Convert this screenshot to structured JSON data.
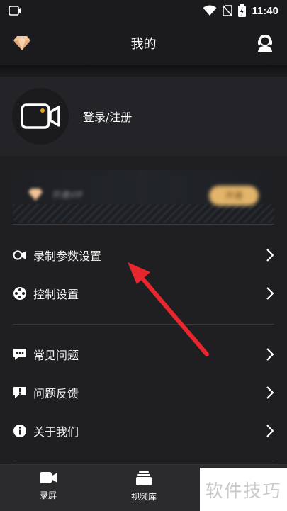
{
  "status_bar": {
    "time": "11:40"
  },
  "header": {
    "title": "我的"
  },
  "profile": {
    "login_label": "登录/注册"
  },
  "vip": {
    "label": "开通VIP",
    "button": "开通"
  },
  "menu": [
    {
      "label": "录制参数设置",
      "icon": "record-settings-icon"
    },
    {
      "label": "控制设置",
      "icon": "control-icon"
    },
    {
      "label": "常见问题",
      "icon": "chat-icon"
    },
    {
      "label": "问题反馈",
      "icon": "feedback-icon"
    },
    {
      "label": "关于我们",
      "icon": "info-icon"
    }
  ],
  "bottom_nav": [
    {
      "label": "录屏",
      "icon": "video-camera-icon"
    },
    {
      "label": "视频库",
      "icon": "video-library-icon"
    }
  ],
  "watermark": "软件技巧",
  "colors": {
    "accent": "#f0a020",
    "arrow": "#e8262e",
    "vip_gold": "#e3b56a"
  }
}
